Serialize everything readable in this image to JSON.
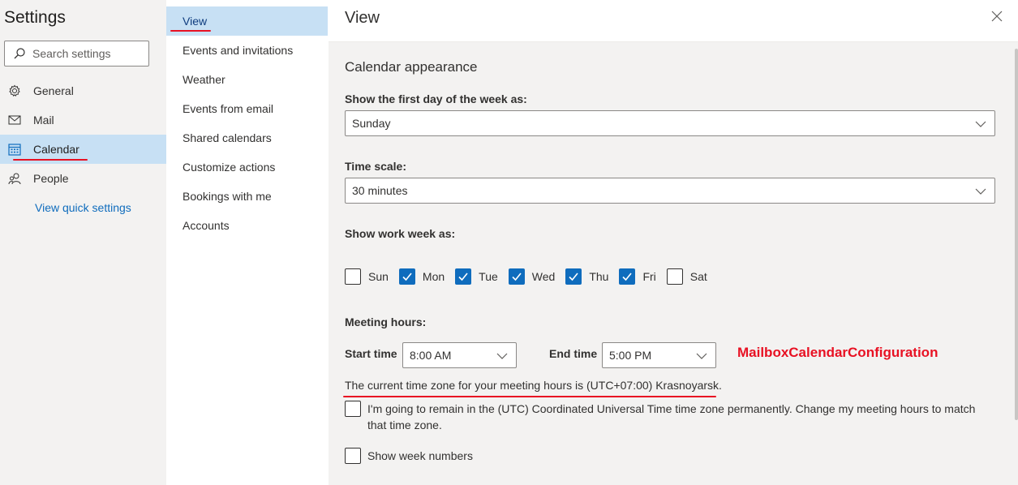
{
  "settings": {
    "title": "Settings",
    "search_placeholder": "Search settings"
  },
  "nav": {
    "items": [
      {
        "label": "General",
        "icon": "gear-icon"
      },
      {
        "label": "Mail",
        "icon": "mail-icon"
      },
      {
        "label": "Calendar",
        "icon": "calendar-icon",
        "selected": true
      },
      {
        "label": "People",
        "icon": "people-icon"
      }
    ],
    "quick_link": "View quick settings"
  },
  "subnav": {
    "items": [
      {
        "label": "View",
        "selected": true
      },
      {
        "label": "Events and invitations"
      },
      {
        "label": "Weather"
      },
      {
        "label": "Events from email"
      },
      {
        "label": "Shared calendars"
      },
      {
        "label": "Customize actions"
      },
      {
        "label": "Bookings with me"
      },
      {
        "label": "Accounts"
      }
    ]
  },
  "view": {
    "title": "View",
    "section_title": "Calendar appearance",
    "first_day_label": "Show the first day of the week as:",
    "first_day_value": "Sunday",
    "time_scale_label": "Time scale:",
    "time_scale_value": "30 minutes",
    "work_week_label": "Show work week as:",
    "days": [
      {
        "label": "Sun",
        "checked": false
      },
      {
        "label": "Mon",
        "checked": true
      },
      {
        "label": "Tue",
        "checked": true
      },
      {
        "label": "Wed",
        "checked": true
      },
      {
        "label": "Thu",
        "checked": true
      },
      {
        "label": "Fri",
        "checked": true
      },
      {
        "label": "Sat",
        "checked": false
      }
    ],
    "meeting_hours_label": "Meeting hours:",
    "start_time_label": "Start time",
    "start_time_value": "8:00 AM",
    "end_time_label": "End time",
    "end_time_value": "5:00 PM",
    "annotation": "MailboxCalendarConfiguration",
    "timezone_note": "The current time zone for your meeting hours is (UTC+07:00) Krasnoyarsk.",
    "remain_utc_option": "I'm going to remain in the (UTC) Coordinated Universal Time time zone permanently. Change my meeting hours to match that time zone.",
    "week_numbers_option": "Show week numbers"
  },
  "colors": {
    "accent": "#0f6cbd",
    "selected_bg": "#c7e0f4",
    "annotation_red": "#e81123"
  }
}
